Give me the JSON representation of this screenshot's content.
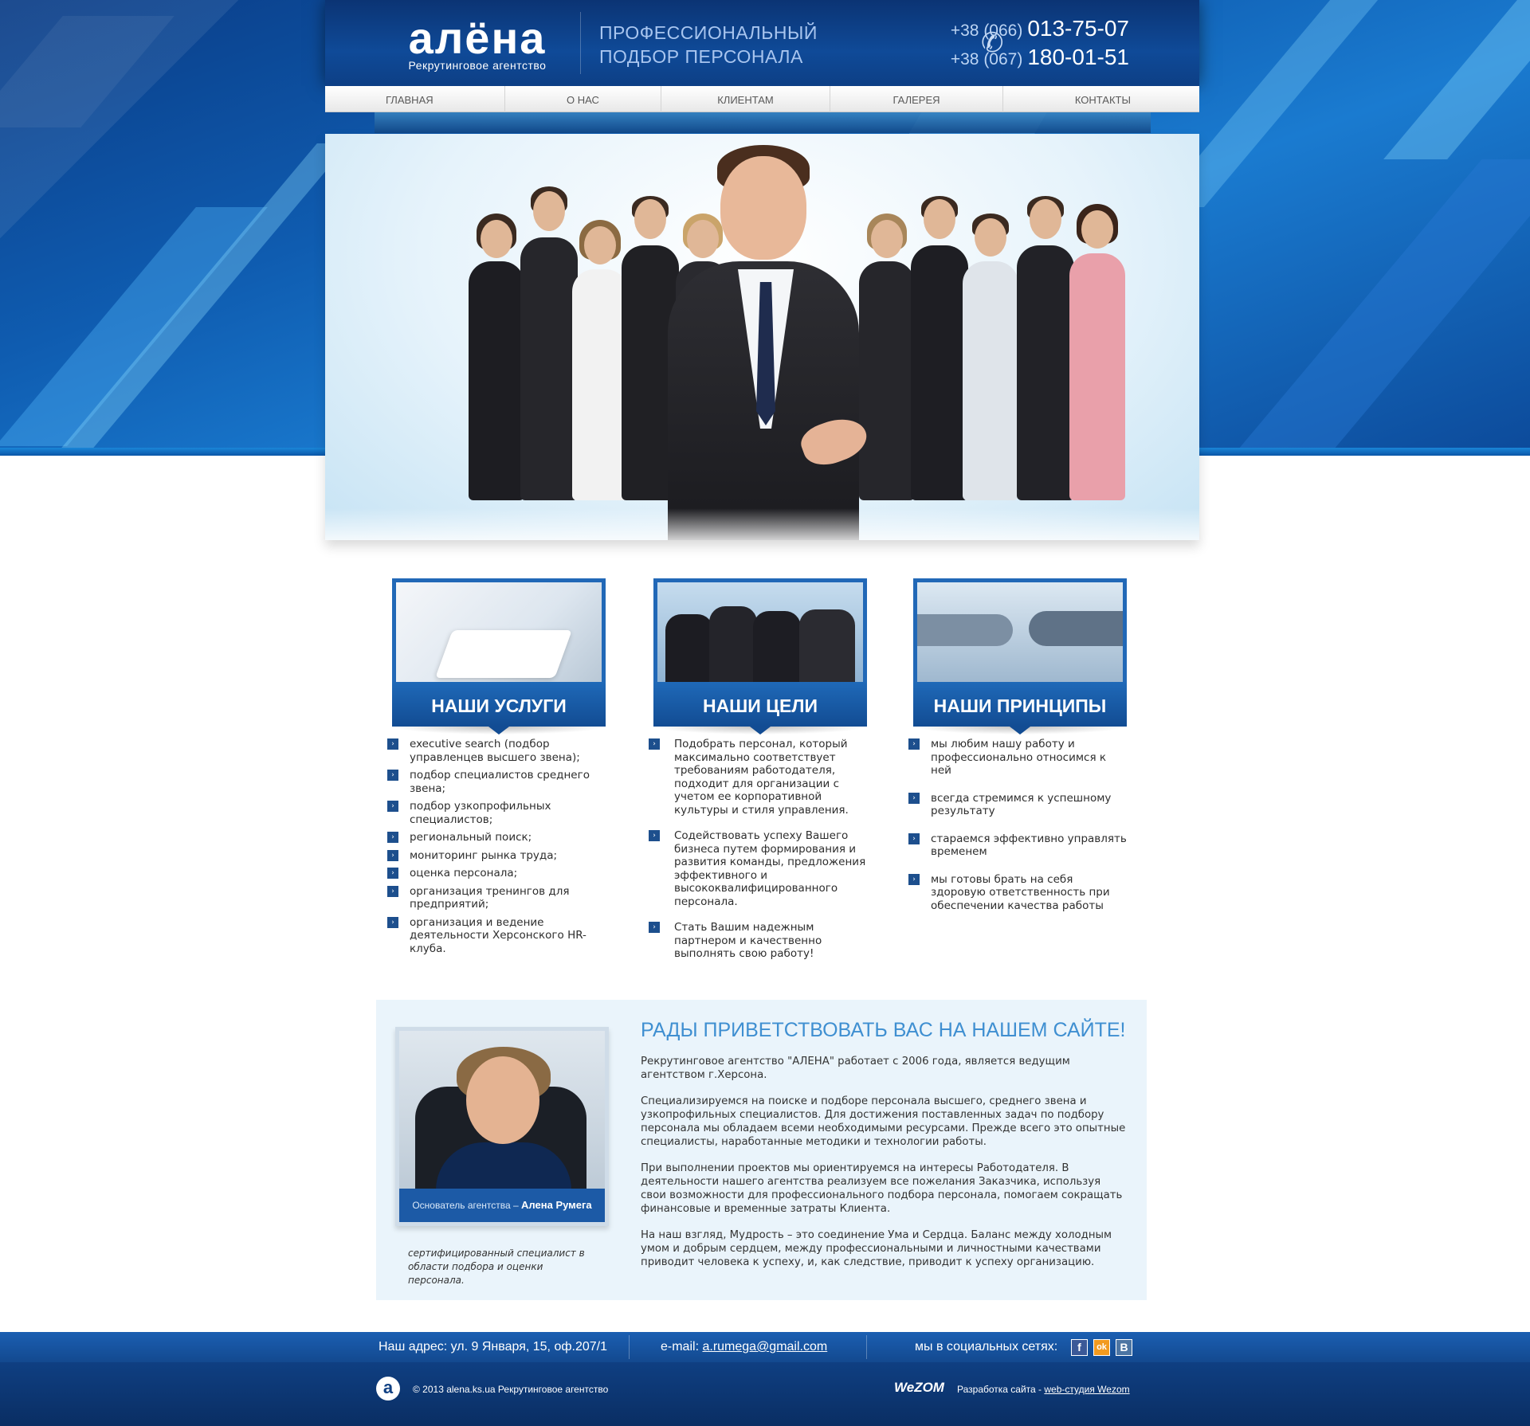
{
  "header": {
    "logo_word": "алёна",
    "logo_sub": "Рекрутинговое агентство",
    "slogan_line1": "ПРОФЕССИОНАЛЬНЫЙ",
    "slogan_line2": "ПОДБОР ПЕРСОНАЛА",
    "phones": [
      {
        "code": "+38 (066)",
        "number": "013-75-07"
      },
      {
        "code": "+38 (067)",
        "number": "180-01-51"
      }
    ]
  },
  "nav": {
    "items": [
      {
        "label": "ГЛАВНАЯ"
      },
      {
        "label": "О НАС"
      },
      {
        "label": "КЛИЕНТАМ"
      },
      {
        "label": "ГАЛЕРЕЯ"
      },
      {
        "label": "КОНТАКТЫ"
      }
    ]
  },
  "columns": [
    {
      "title": "НАШИ УСЛУГИ",
      "items": [
        "executive search (подбор управленцев высшего звена);",
        "подбор специалистов среднего звена;",
        "подбор узкопрофильных специалистов;",
        "региональный поиск;",
        "мониторинг рынка труда;",
        "оценка персонала;",
        "организация тренингов для предприятий;",
        "организация и ведение деятельности Херсонского HR-клуба."
      ]
    },
    {
      "title": "НАШИ ЦЕЛИ",
      "items": [
        "Подобрать персонал, который максимально соответствует требованиям работодателя, подходит для организации с учетом ее корпоративной культуры и стиля управления.",
        "Содействовать успеху Вашего бизнеса путем формирования и развития команды, предложения эффективного и высококвалифицированного персонала.",
        "Стать Вашим надежным партнером и качественно выполнять свою работу!"
      ]
    },
    {
      "title": "НАШИ ПРИНЦИПЫ",
      "items": [
        "мы любим нашу работу и профессионально относимся к ней",
        "всегда стремимся к успешному результату",
        "стараемся эффективно управлять временем",
        "мы готовы брать на себя здоровую ответственность при обеспечении качества работы"
      ]
    }
  ],
  "welcome": {
    "title": "РАДЫ ПРИВЕТСТВОВАТЬ ВАС НА НАШЕМ САЙТЕ!",
    "paragraphs": [
      "Рекрутинговое агентство \"АЛЕНА\" работает с 2006 года, является ведущим агентством г.Херсона.",
      "Специализируемся на поиске и подборе персонала высшего, среднего звена и узкопрофильных специалистов. Для достижения поставленных задач по подбору персонала мы обладаем всеми необходимыми ресурсами. Прежде всего это опытные специалисты, наработанные методики и технологии работы.",
      "При выполнении проектов мы ориентируемся на интересы Работодателя. В деятельности нашего агентства реализуем все пожелания Заказчика, используя свои возможности для профессионального подбора персонала, помогаем сокращать финансовые и временные затраты Клиента.",
      "На наш взгляд, Мудрость – это соединение Ума и Сердца. Баланс между холодным умом и добрым сердцем, между профессиональными и личностными качествами приводит человека к успеху, и, как следствие, приводит к успеху организацию."
    ],
    "founder_caption_prefix": "Основатель агентства –",
    "founder_name": "Алена Румега",
    "founder_note": "сертифицированный специалист в области подбора и оценки персонала."
  },
  "footer": {
    "address": "Наш адрес: ул. 9 Января, 15, оф.207/1",
    "email_label": "e-mail:",
    "email": "a.rumega@gmail.com",
    "social_label": "мы в социальных сетях:",
    "social": [
      {
        "icon": "facebook-icon",
        "glyph": "f"
      },
      {
        "icon": "odnoklassniki-icon",
        "glyph": "ok"
      },
      {
        "icon": "vkontakte-icon",
        "glyph": "B"
      }
    ],
    "copyright": "© 2013  alena.ks.ua  Рекрутинговое агентство",
    "dev_label": "Разработка сайта -",
    "dev_link": "web-студия Wezom",
    "wezom_logo": "WeZOM"
  },
  "colors": {
    "brand_blue": "#124c93",
    "accent_light": "#3f8fd1",
    "footer_blue": "#13498f"
  }
}
